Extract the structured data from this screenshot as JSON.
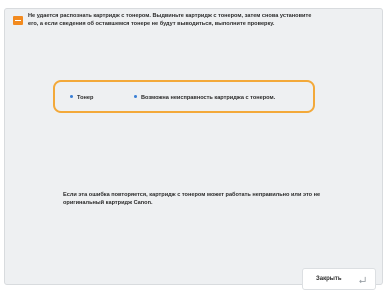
{
  "dialog": {
    "message": "Не удается распознать картридж с тонером. Выдвиньте картридж с тонером, затем снова установите его, а если сведения об оставшемся тонере не будут выводиться, выполните проверку.",
    "items": [
      {
        "label": "Тонер"
      },
      {
        "label": "Возможна неисправность картриджа с тонером."
      }
    ],
    "note": "Если эта ошибка повторяется, картридж с тонером может работать неправильно или это не оригинальный картридж Canon.",
    "close_label": "Закрыть"
  },
  "colors": {
    "panel_bg": "#eef0f2",
    "warning_icon": "#f28a1f",
    "highlight_border": "#f3a93a",
    "bullet": "#3a7fd5"
  },
  "icons": {
    "warning": "warning-icon",
    "enter": "enter-key-icon"
  }
}
